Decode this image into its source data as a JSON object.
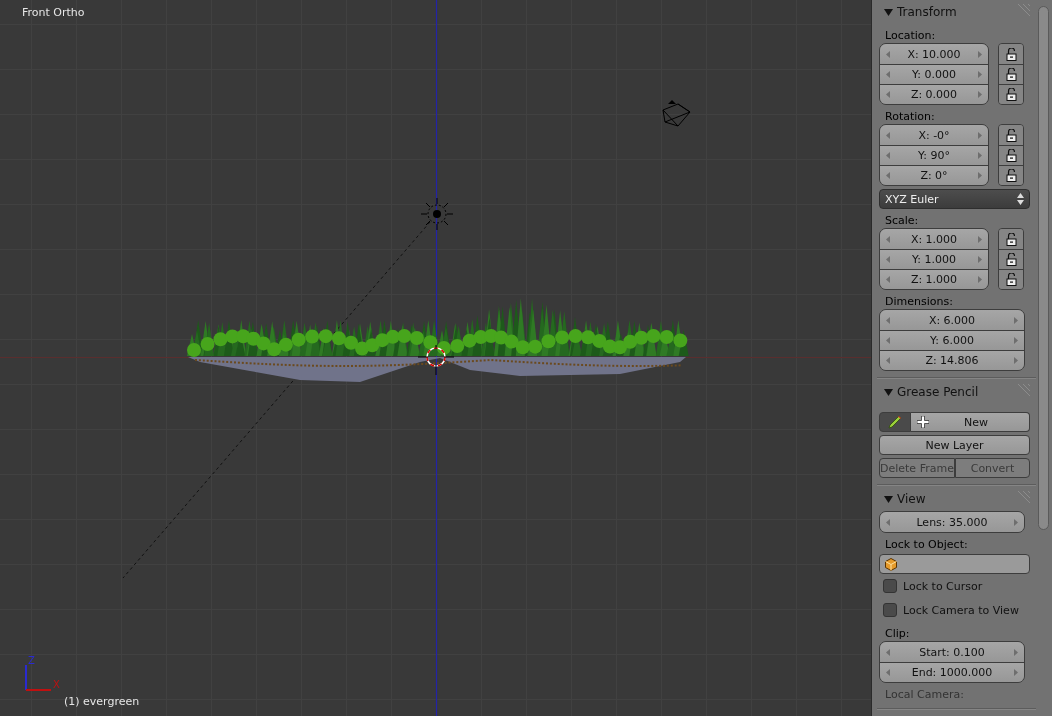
{
  "viewport": {
    "view_name": "Front Ortho",
    "object_label": "(1) evergreen",
    "axis_labels": [
      "Z",
      "X"
    ]
  },
  "panel": {
    "sections": [
      {
        "title": "Transform",
        "expanded": true,
        "items": [
          {
            "kind": "label",
            "text": "Location:"
          },
          {
            "kind": "vector",
            "fields": [
              "X: 10.000",
              "Y: 0.000",
              "Z: 0.000"
            ],
            "locks": [
              false,
              false,
              false
            ]
          },
          {
            "kind": "label",
            "text": "Rotation:"
          },
          {
            "kind": "vector",
            "fields": [
              "X: -0°",
              "Y: 90°",
              "Z: 0°"
            ],
            "locks": [
              false,
              false,
              false
            ]
          },
          {
            "kind": "dropdown",
            "value": "XYZ Euler"
          },
          {
            "kind": "label",
            "text": "Scale:"
          },
          {
            "kind": "vector",
            "fields": [
              "X: 1.000",
              "Y: 1.000",
              "Z: 1.000"
            ],
            "locks": [
              false,
              false,
              false
            ]
          },
          {
            "kind": "label",
            "text": "Dimensions:"
          },
          {
            "kind": "vector",
            "fields": [
              "X: 6.000",
              "Y: 6.000",
              "Z: 14.806"
            ]
          }
        ]
      },
      {
        "title": "Grease Pencil",
        "expanded": true,
        "items": [
          {
            "kind": "pencil_new",
            "label": "New"
          },
          {
            "kind": "buttons",
            "buttons": [
              {
                "label": "New Layer",
                "disabled": false
              }
            ]
          },
          {
            "kind": "buttons",
            "buttons": [
              {
                "label": "Delete Frame",
                "disabled": true
              },
              {
                "label": "Convert",
                "disabled": true
              }
            ]
          }
        ]
      },
      {
        "title": "View",
        "expanded": true,
        "items": [
          {
            "kind": "vector",
            "fields": [
              "Lens: 35.000"
            ]
          },
          {
            "kind": "label",
            "text": "Lock to Object:"
          },
          {
            "kind": "object_field"
          },
          {
            "kind": "checkbox",
            "label": "Lock to Cursor",
            "checked": false
          },
          {
            "kind": "checkbox",
            "label": "Lock Camera to View",
            "checked": false
          },
          {
            "kind": "label",
            "text": "Clip:"
          },
          {
            "kind": "vector",
            "fields": [
              "Start: 0.100",
              "End: 1000.000"
            ]
          },
          {
            "kind": "label",
            "text": "Local Camera:",
            "disabled": true
          }
        ]
      }
    ]
  }
}
